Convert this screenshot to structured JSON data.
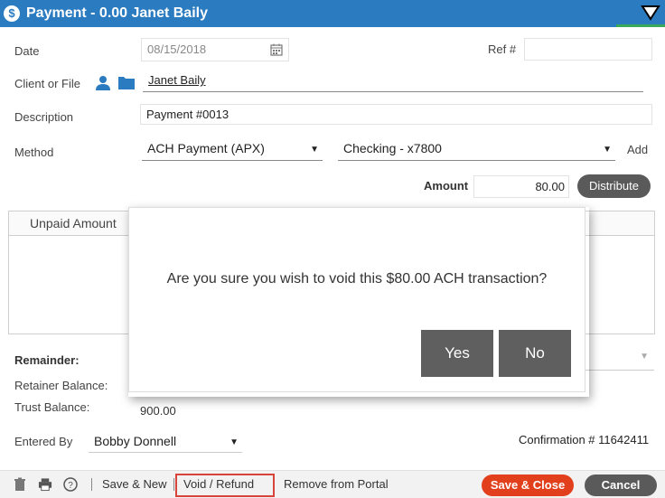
{
  "title": {
    "text": "Payment - 0.00  Janet Baily",
    "icon": "dollar-icon"
  },
  "form": {
    "date_label": "Date",
    "date_value": "08/15/2018",
    "ref_label": "Ref #",
    "ref_value": "",
    "client_label": "Client or File",
    "client_value": "Janet Baily",
    "description_label": "Description",
    "description_value": "Payment #0013",
    "method_label": "Method",
    "method_value": "ACH Payment (APX)",
    "account_value": "Checking - x7800",
    "add_link": "Add",
    "amount_label": "Amount",
    "amount_value": "80.00",
    "distribute_button": "Distribute"
  },
  "table": {
    "col_unpaid": "Unpaid Amount"
  },
  "summary": {
    "remainder_label": "Remainder:",
    "retainer_label": "Retainer Balance:",
    "trust_label": "Trust Balance:",
    "trust_value": "900.00",
    "entered_by_label": "Entered By",
    "entered_by_value": "Bobby Donnell",
    "confirmation": "Confirmation # 11642411"
  },
  "dialog": {
    "message": "Are you sure you wish to void this $80.00 ACH transaction?",
    "yes": "Yes",
    "no": "No"
  },
  "bottom": {
    "save_new": "Save & New",
    "void_refund": "Void / Refund",
    "remove_portal": "Remove from Portal",
    "save_close": "Save & Close",
    "cancel": "Cancel"
  },
  "colors": {
    "title_bg": "#2a7bc0",
    "save_close": "#e2401c",
    "void_outline": "#d9443a",
    "dialog_button": "#5f5f5f"
  }
}
